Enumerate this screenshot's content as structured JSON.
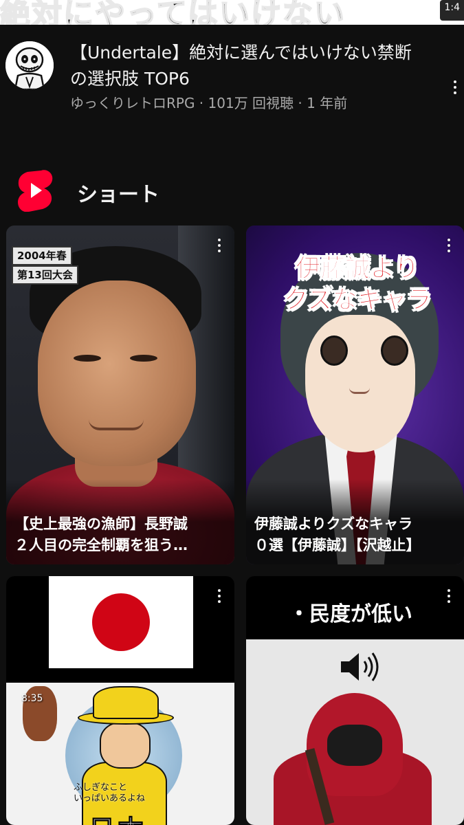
{
  "top_banner": {
    "text": "絶対にやってはいけない",
    "duration": "1:4"
  },
  "video": {
    "title": "【Undertale】絶対に選んではいけない禁断の選択肢 TOP6",
    "meta": "ゆっくりレトロRPG · 101万 回視聴 · 1 年前"
  },
  "shorts": {
    "section_label": "ショート",
    "items": [
      {
        "caption_line1": "【史上最強の漁師】長野誠",
        "caption_line2": "２人目の完全制覇を狙う…",
        "badge1": "2004年春",
        "badge2": "第13回大会"
      },
      {
        "caption_line1": "伊藤誠よりクズなキャラ",
        "caption_line2": "０選【伊藤誠】【沢越止】",
        "overlay_line1": "伊藤誠より",
        "overlay_line2": "クズなキャラ"
      },
      {
        "time": "8:35",
        "subtitle1": "ふしぎなこと",
        "subtitle2": "いっぱいあるよね",
        "bottom_text": "日本"
      },
      {
        "overlay": "・民度が低い"
      }
    ]
  },
  "colors": {
    "background": "#0f0f0f",
    "shorts_red": "#ff0033",
    "secondary_text": "#aaaaaa"
  }
}
